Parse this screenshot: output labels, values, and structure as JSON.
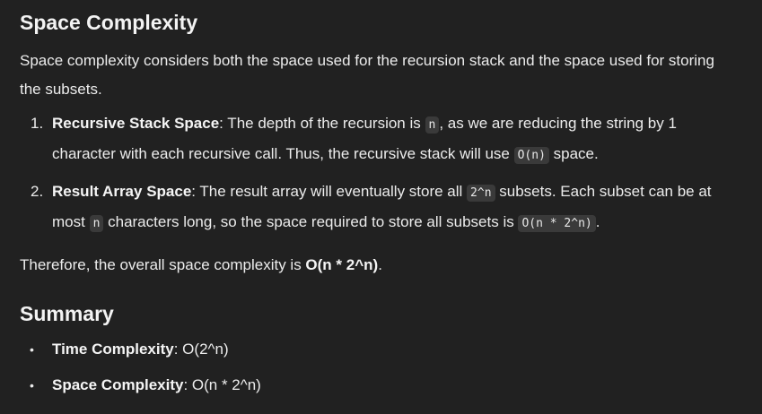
{
  "sections": {
    "space": {
      "heading": "Space Complexity",
      "intro": "Space complexity considers both the space used for the recursion stack and the space used for storing the subsets.",
      "items": [
        {
          "marker": "1.",
          "title": "Recursive Stack Space",
          "t1": ": The depth of the recursion is ",
          "c1": "n",
          "t2": ", as we are reducing the string by 1 character with each recursive call. Thus, the recursive stack will use ",
          "c2": "O(n)",
          "t3": " space."
        },
        {
          "marker": "2.",
          "title": "Result Array Space",
          "t1": ": The result array will eventually store all ",
          "c1": "2^n",
          "t2": " subsets. Each subset can be at most ",
          "c2": "n",
          "t3": " characters long, so the space required to store all subsets is ",
          "c3": "O(n * 2^n)",
          "t4": "."
        }
      ],
      "conclusion_prefix": "Therefore, the overall space complexity is ",
      "conclusion_bold": "O(n * 2^n)",
      "conclusion_suffix": "."
    },
    "summary": {
      "heading": "Summary",
      "items": [
        {
          "marker": "•",
          "label": "Time Complexity",
          "value": ": O(2^n)"
        },
        {
          "marker": "•",
          "label": "Space Complexity",
          "value": ": O(n * 2^n)"
        }
      ]
    }
  }
}
